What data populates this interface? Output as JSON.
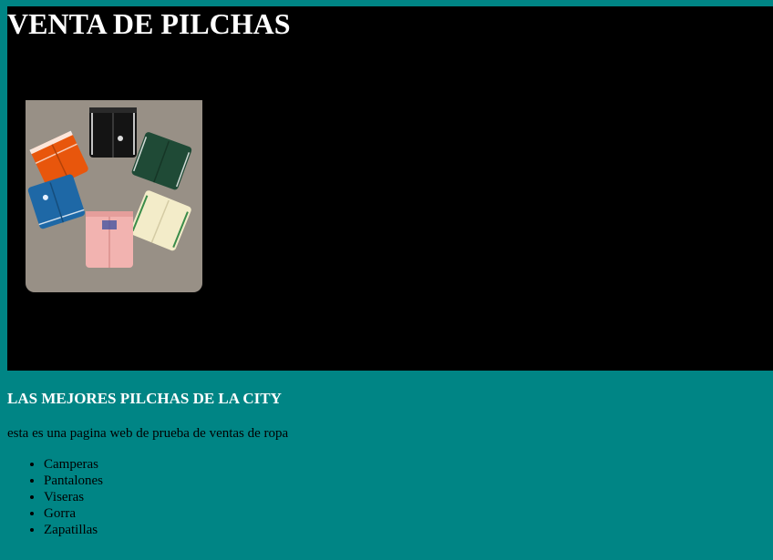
{
  "header": {
    "title": "VENTA DE PILCHAS"
  },
  "hero": {
    "image_alt": "ropa deportiva",
    "image_icon": "product-photo"
  },
  "main": {
    "subtitle": "LAS MEJORES PILCHAS DE LA CITY",
    "intro": "esta es una pagina web de prueba de ventas de ropa",
    "categories": [
      "Camperas",
      "Pantalones",
      "Viseras",
      "Gorra",
      "Zapatillas"
    ]
  },
  "colors": {
    "page_background": "#008585",
    "hero_background": "#000000",
    "heading_text": "#ffffff",
    "body_text": "#000000"
  }
}
